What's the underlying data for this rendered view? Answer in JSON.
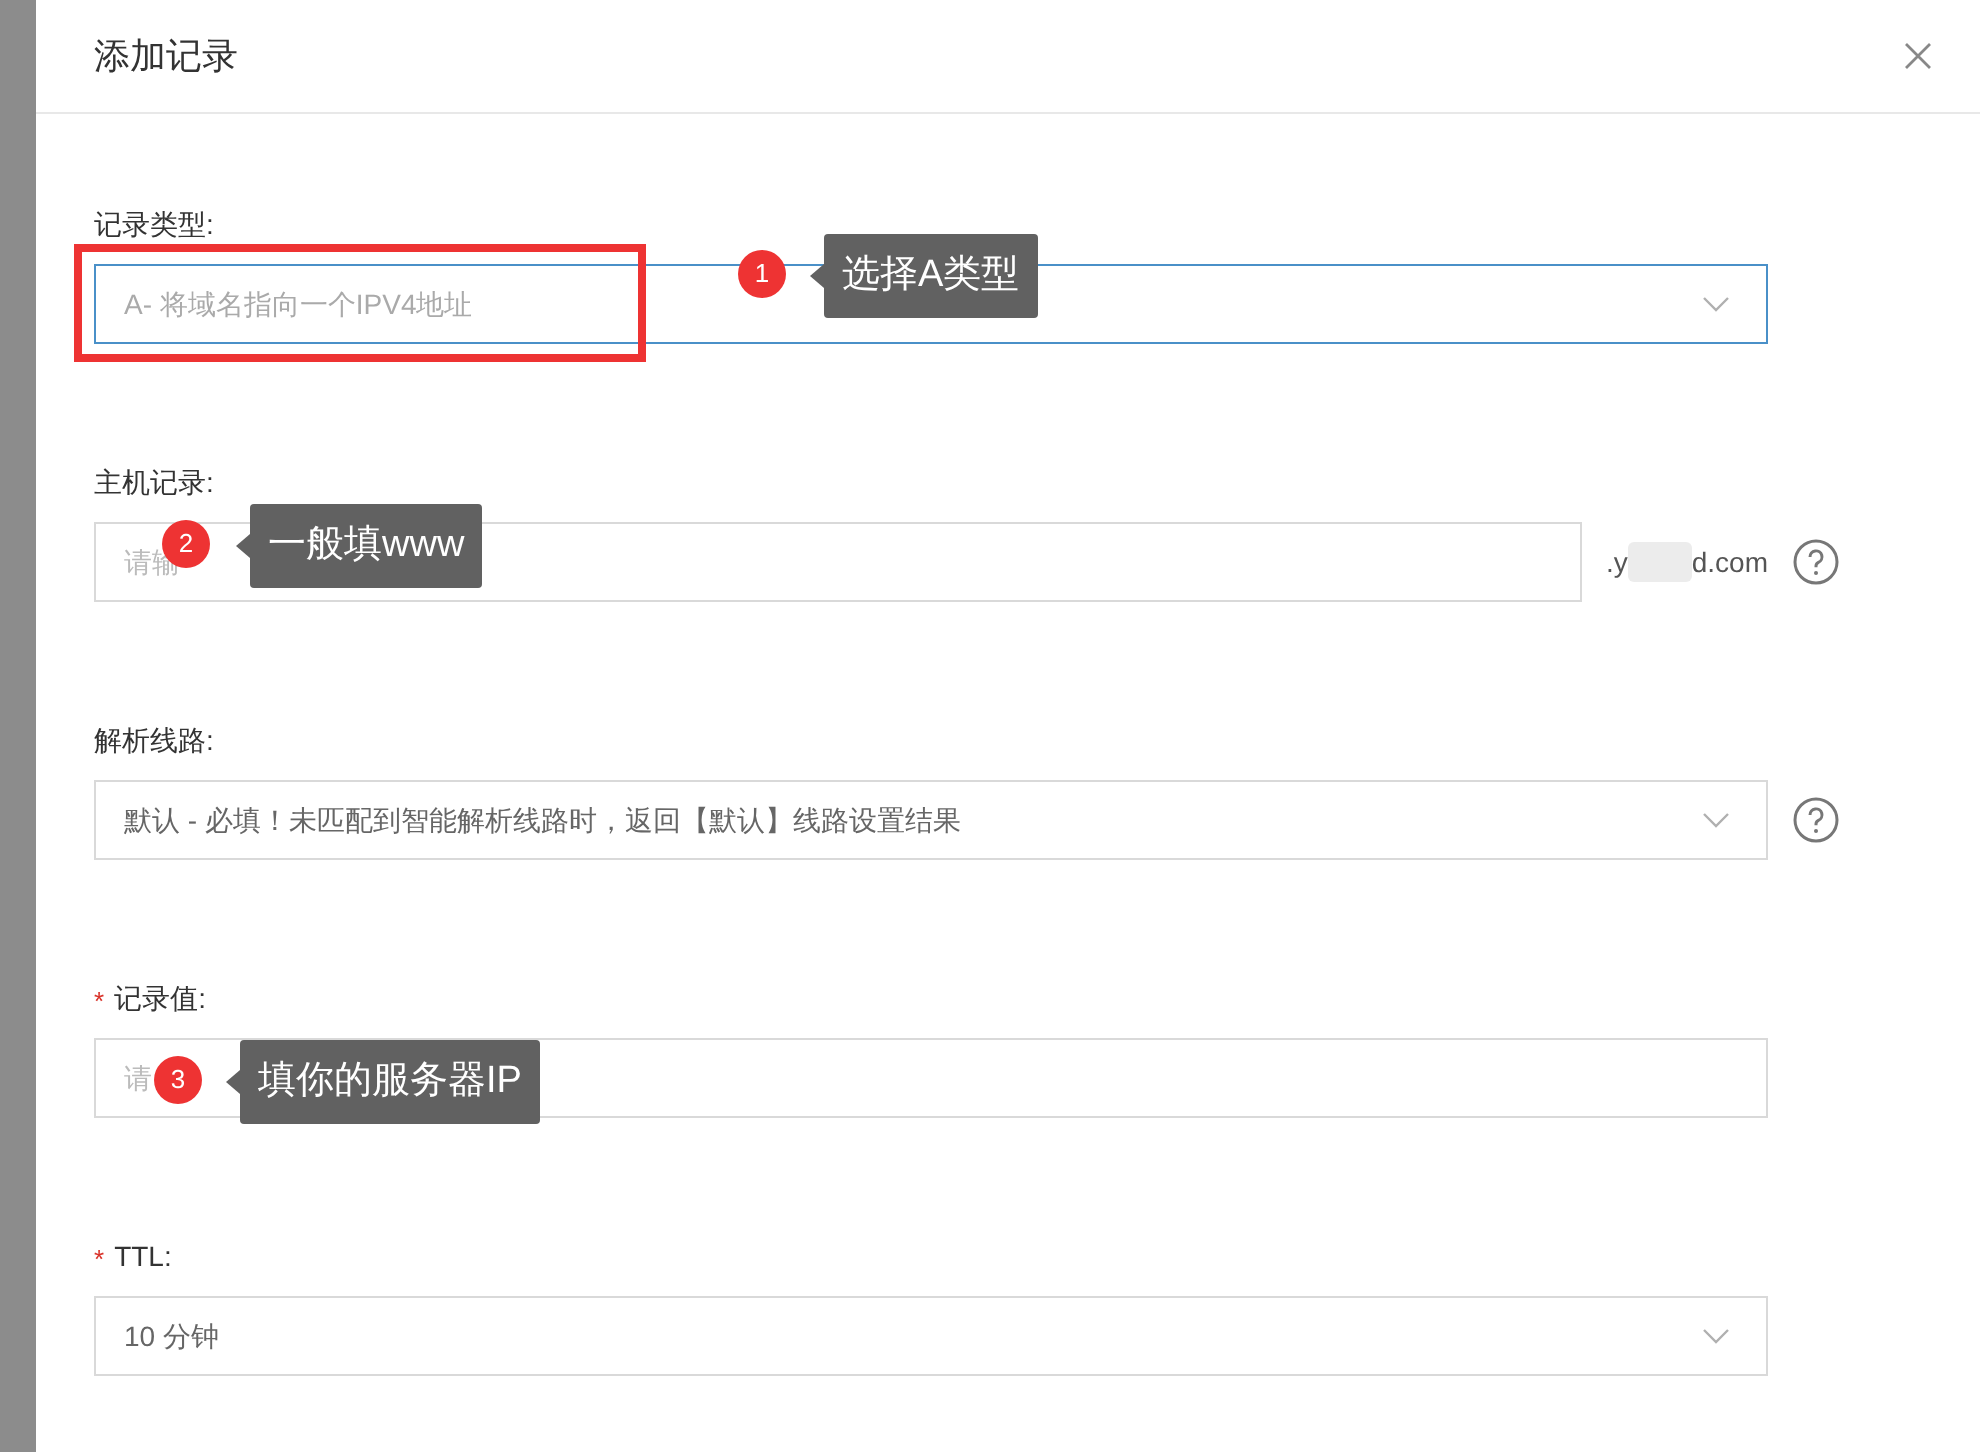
{
  "dialog": {
    "title": "添加记录"
  },
  "fields": [
    {
      "kind": "select",
      "label": "记录类型:",
      "placeholder": "A- 将域名指向一个IPV4地址",
      "focused": true,
      "highlighted": true,
      "help": false,
      "annotation": {
        "number": "1",
        "text": "选择A类型"
      }
    },
    {
      "kind": "suffix-input",
      "label": "主机记录:",
      "placeholder": "请输",
      "suffix_start": ".y",
      "suffix_end": "d.com",
      "focused": false,
      "highlighted": false,
      "help": true,
      "annotation": {
        "number": "2",
        "text": "一般填www"
      }
    },
    {
      "kind": "select",
      "label": "解析线路:",
      "value": "默认 - 必填！未匹配到智能解析线路时，返回【默认】线路设置结果",
      "focused": false,
      "highlighted": false,
      "help": true
    },
    {
      "kind": "input",
      "required_mark": "*",
      "label": "记录值:",
      "placeholder": "请",
      "focused": false,
      "highlighted": false,
      "help": false,
      "annotation": {
        "number": "3",
        "text": "填你的服务器IP"
      }
    },
    {
      "kind": "select",
      "required_mark": "*",
      "label": "TTL:",
      "value": "10 分钟",
      "focused": false,
      "highlighted": false,
      "help": false
    }
  ]
}
